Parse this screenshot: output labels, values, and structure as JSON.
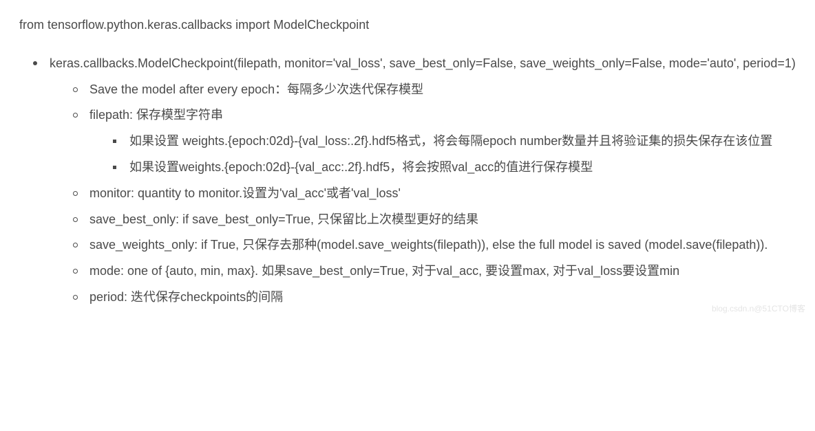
{
  "import_line": "from tensorflow.python.keras.callbacks import ModelCheckpoint",
  "main_item": "keras.callbacks.ModelCheckpoint(filepath, monitor='val_loss', save_best_only=False, save_weights_only=False, mode='auto', period=1)",
  "sub_items": {
    "save_epoch": "Save the model after every epoch：每隔多少次迭代保存模型",
    "filepath": "filepath: 保存模型字符串",
    "filepath_sub1": "如果设置 weights.{epoch:02d}-{val_loss:.2f}.hdf5格式，将会每隔epoch number数量并且将验证集的损失保存在该位置",
    "filepath_sub2": "如果设置weights.{epoch:02d}-{val_acc:.2f}.hdf5，将会按照val_acc的值进行保存模型",
    "monitor": "monitor: quantity to monitor.设置为'val_acc'或者'val_loss'",
    "save_best_only": "save_best_only: if save_best_only=True, 只保留比上次模型更好的结果",
    "save_weights_only": "save_weights_only: if True, 只保存去那种(model.save_weights(filepath)), else the full model is saved (model.save(filepath)).",
    "mode": "mode: one of {auto, min, max}. 如果save_best_only=True, 对于val_acc, 要设置max, 对于val_loss要设置min",
    "period": "period: 迭代保存checkpoints的间隔"
  },
  "watermark": "blog.csdn.n@51CTO博客"
}
